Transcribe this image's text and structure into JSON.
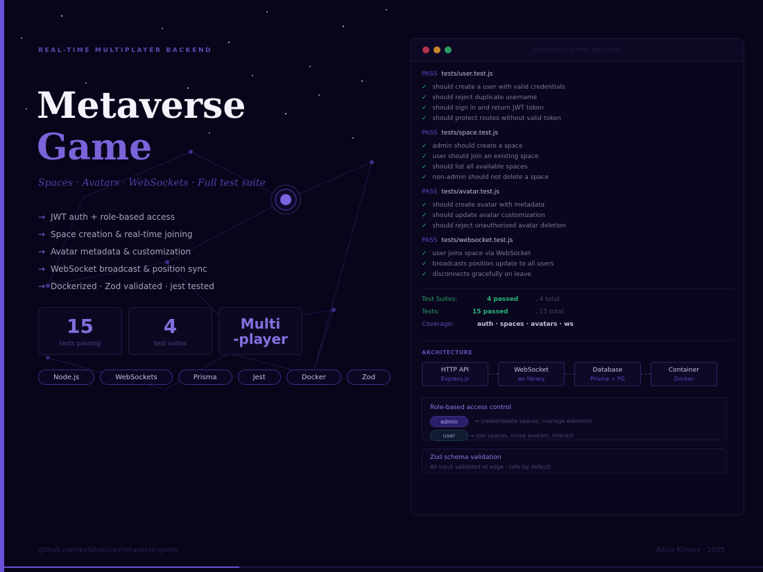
{
  "eyebrow": "REAL-TIME MULTIPLAYER BACKEND",
  "title": {
    "line1": "Metaverse",
    "line2": "Game"
  },
  "subtitle": "Spaces · Avatars · WebSockets · Full test suite",
  "features": [
    "JWT auth + role-based access",
    "Space creation & real-time joining",
    "Avatar metadata & customization",
    "WebSocket broadcast & position sync",
    "Dockerized · Zod validated · jest tested"
  ],
  "feature_arrow": "→",
  "stats": [
    {
      "value": "15",
      "label": "tests passing"
    },
    {
      "value": "4",
      "label": "test suites"
    },
    {
      "value": "Multi\n-player",
      "label": ""
    }
  ],
  "chips": [
    "Node.js",
    "WebSockets",
    "Prisma",
    "Jest",
    "Docker",
    "Zod"
  ],
  "footer": {
    "repo": "github.com/kylahalicia/metaverse-game",
    "author": "Alicia Kimani · 2025"
  },
  "terminal": {
    "title": "metaverse-game: jest tests",
    "pass_label": "PASS",
    "check": "✓",
    "suites": [
      {
        "file": "tests/user.test.js",
        "cases": [
          "should create a user with valid credentials",
          "should reject duplicate username",
          "should sign in and return JWT token",
          "should protect routes without valid token"
        ]
      },
      {
        "file": "tests/space.test.js",
        "cases": [
          "admin should create a space",
          "user should join an existing space",
          "should list all available spaces",
          "non-admin should not delete a space"
        ]
      },
      {
        "file": "tests/avatar.test.js",
        "cases": [
          "should create avatar with metadata",
          "should update avatar customization",
          "should reject unauthorized avatar deletion"
        ]
      },
      {
        "file": "tests/websocket.test.js",
        "cases": [
          "user joins space via WebSocket",
          "broadcasts position update to all users",
          "disconnects gracefully on leave"
        ]
      }
    ],
    "summary": {
      "suites_label": "Test Suites:",
      "suites_value": "4 passed",
      "suites_total": ", 4 total",
      "tests_label": "Tests:",
      "tests_value": "15 passed",
      "tests_total": ", 15 total",
      "coverage_label": "Coverage:",
      "coverage_value": "auth · spaces · avatars · ws"
    },
    "architecture": {
      "title": "ARCHITECTURE",
      "boxes": [
        {
          "name": "HTTP API",
          "sub": "Express.js"
        },
        {
          "name": "WebSocket",
          "sub": "ws library"
        },
        {
          "name": "Database",
          "sub": "Prisma + PG"
        },
        {
          "name": "Container",
          "sub": "Docker"
        }
      ]
    },
    "rbac": {
      "title": "Role-based access control",
      "roles": [
        {
          "name": "admin",
          "desc": "→ create/delete spaces, manage elements"
        },
        {
          "name": "user",
          "desc": "→ join spaces, move avatars, interact"
        }
      ]
    },
    "zod": {
      "title": "Zod schema validation",
      "desc": "All input validated at edge · safe by default"
    }
  },
  "colors": {
    "accent": "#6b50d8",
    "pass": "#2eb57d",
    "background": "#08051a"
  }
}
